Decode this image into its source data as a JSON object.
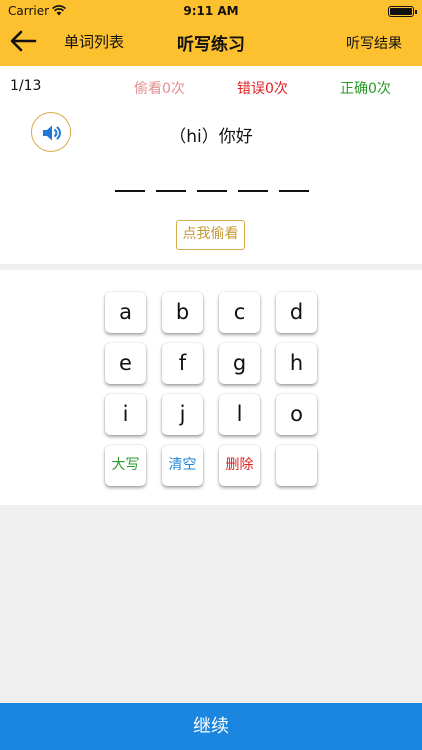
{
  "status_bar": {
    "carrier": "Carrier",
    "time": "9:11 AM"
  },
  "nav": {
    "left_link": "单词列表",
    "title": "听写练习",
    "right_link": "听写结果"
  },
  "stats": {
    "progress": "1/13",
    "peek": "偷看0次",
    "wrong": "错误0次",
    "right": "正确0次"
  },
  "word": {
    "hint": "（hi）你好",
    "blank_count": 5
  },
  "peek_button": "点我偷看",
  "keyboard": {
    "rows": [
      [
        "a",
        "b",
        "c",
        "d"
      ],
      [
        "e",
        "f",
        "g",
        "h"
      ],
      [
        "i",
        "j",
        "l",
        "o"
      ]
    ],
    "caps_label": "大写",
    "clear_label": "清空",
    "delete_label": "删除",
    "blank_key_label": ""
  },
  "continue_button": "继续",
  "colors": {
    "header": "#fdc02f",
    "peek_text": "#e29090",
    "wrong_text": "#e02020",
    "right_text": "#2a9a2a",
    "gold_border": "#d9ab4a",
    "continue": "#1a86e0"
  }
}
